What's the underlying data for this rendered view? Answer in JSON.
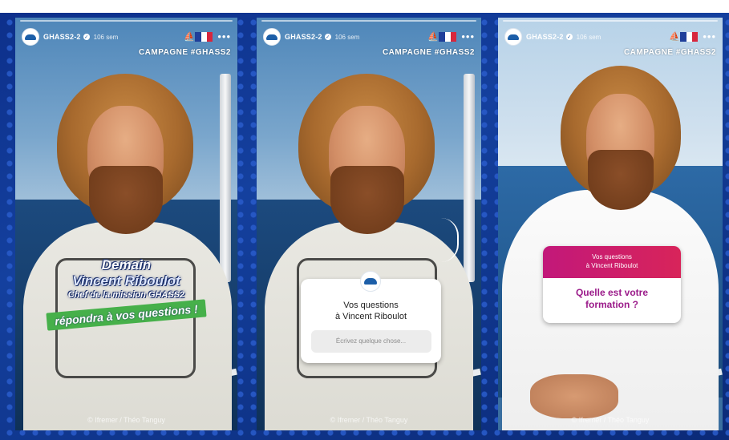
{
  "stories": [
    {
      "account": "GHASS2-2",
      "time": "106 sem",
      "campaign": "CAMPAGNE #GHASS2",
      "credit": "© Ifremer / Théo Tanguy",
      "overlay": {
        "title": "Demain",
        "name": "Vincent Riboulot",
        "role": "Chef de la mission GHASS2",
        "cta": "répondra à vos questions !"
      }
    },
    {
      "account": "GHASS2-2",
      "time": "106 sem",
      "campaign": "CAMPAGNE #GHASS2",
      "credit": "© Ifremer / Théo Tanguy",
      "question_box": {
        "title_line1": "Vos questions",
        "title_line2": "à Vincent Riboulot",
        "placeholder": "Écrivez quelque chose..."
      }
    },
    {
      "account": "GHASS2-2",
      "time": "106 sem",
      "campaign": "CAMPAGNE #GHASS2",
      "credit": "© Ifremer / Théo Tanguy",
      "answer_box": {
        "header_line1": "Vos questions",
        "header_line2": "à Vincent Riboulot",
        "question_line1": "Quelle est votre",
        "question_line2": "formation ?"
      }
    }
  ],
  "colors": {
    "frame_blue": "#14409e",
    "cta_green": "#46b04a",
    "answer_magenta": "#c2187a",
    "question_text": "#9b1b8a"
  },
  "icons": [
    "ifremer-logo-icon",
    "verified-icon",
    "french-flag-icon",
    "more-options-icon"
  ]
}
